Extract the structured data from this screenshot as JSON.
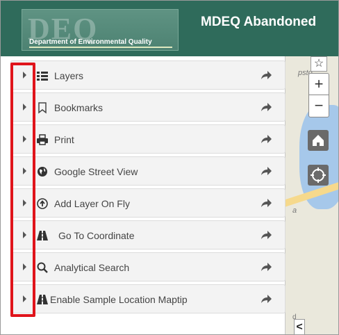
{
  "header": {
    "logo_letters": "DEQ",
    "logo_caption": "Department of Environmental Quality",
    "title": "MDEQ Abandoned"
  },
  "sidebar": {
    "items": [
      {
        "label": "Layers",
        "icon": "layers-list-icon"
      },
      {
        "label": "Bookmarks",
        "icon": "bookmark-icon"
      },
      {
        "label": "Print",
        "icon": "printer-icon"
      },
      {
        "label": "Google Street View",
        "icon": "globe-icon"
      },
      {
        "label": "Add Layer On Fly",
        "icon": "upload-circle-icon"
      },
      {
        "label": "Go To Coordinate",
        "icon": "road-icon"
      },
      {
        "label": "Analytical Search",
        "icon": "search-icon"
      },
      {
        "label": "Enable Sample Location Maptip",
        "icon": "road-icon"
      }
    ]
  },
  "map": {
    "label_top": "psto",
    "label_mid": "a",
    "label_bottom": "d",
    "star": "☆",
    "zoom_in": "+",
    "zoom_out": "−",
    "collapse": "<"
  },
  "colors": {
    "header": "#2f6b5b",
    "highlight": "#e0141b",
    "item_bg": "#f3f3f3"
  }
}
